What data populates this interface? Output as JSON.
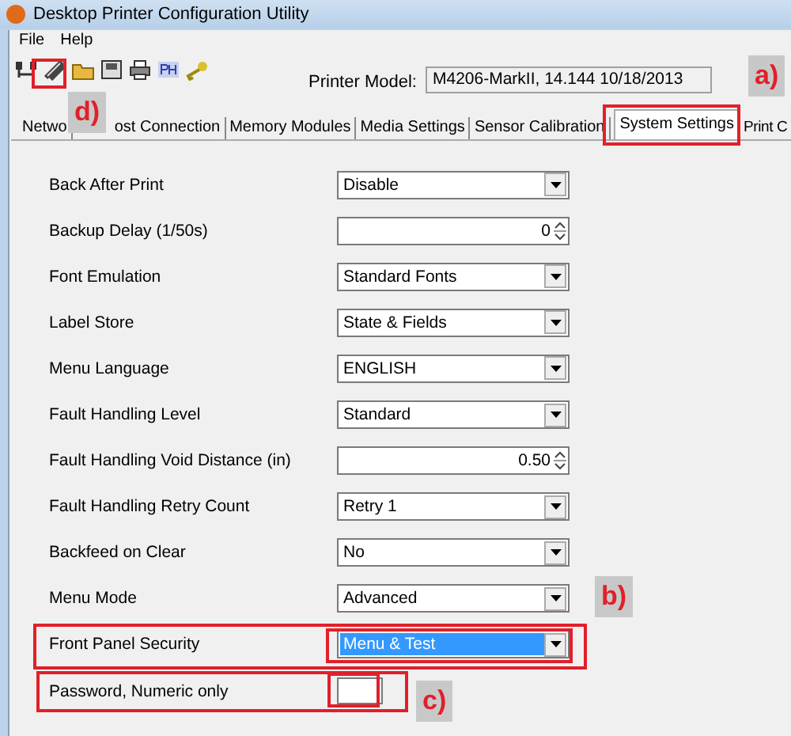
{
  "window": {
    "title": "Desktop Printer Configuration Utility"
  },
  "menu": [
    "File",
    "Help"
  ],
  "printer_model": {
    "label": "Printer Model:",
    "value": "M4206-MarkII, 14.144 10/18/2013"
  },
  "tabs": [
    {
      "label": "Netwo",
      "selected": false
    },
    {
      "label": "ost Connection",
      "selected": false
    },
    {
      "label": "Memory Modules",
      "selected": false
    },
    {
      "label": "Media Settings",
      "selected": false
    },
    {
      "label": "Sensor Calibration",
      "selected": false
    },
    {
      "label": "System Settings",
      "selected": true
    },
    {
      "label": "Print C",
      "selected": false
    }
  ],
  "settings": [
    {
      "label": "Back After Print",
      "kind": "dropdown",
      "value": "Disable",
      "highlighted": false
    },
    {
      "label": "Backup Delay (1/50s)",
      "kind": "spin",
      "value": "0",
      "highlighted": false
    },
    {
      "label": "Font Emulation",
      "kind": "dropdown",
      "value": "Standard Fonts",
      "highlighted": false
    },
    {
      "label": "Label Store",
      "kind": "dropdown",
      "value": "State & Fields",
      "highlighted": false
    },
    {
      "label": "Menu Language",
      "kind": "dropdown",
      "value": "ENGLISH",
      "highlighted": false
    },
    {
      "label": "Fault Handling Level",
      "kind": "dropdown",
      "value": "Standard",
      "highlighted": false
    },
    {
      "label": "Fault Handling Void Distance (in)",
      "kind": "spin",
      "value": "0.50",
      "highlighted": false
    },
    {
      "label": "Fault Handling Retry Count",
      "kind": "dropdown",
      "value": "Retry 1",
      "highlighted": false
    },
    {
      "label": "Backfeed on Clear",
      "kind": "dropdown",
      "value": "No",
      "highlighted": false
    },
    {
      "label": "Menu Mode",
      "kind": "dropdown",
      "value": "Advanced",
      "highlighted": false
    },
    {
      "label": "Front Panel Security",
      "kind": "dropdown",
      "value": "Menu & Test",
      "highlighted": true
    },
    {
      "label": "Password, Numeric only",
      "kind": "text",
      "highlighted": false
    }
  ],
  "annotations": [
    {
      "label": "a)"
    },
    {
      "label": "b)"
    },
    {
      "label": "c)"
    },
    {
      "label": "d)"
    }
  ]
}
